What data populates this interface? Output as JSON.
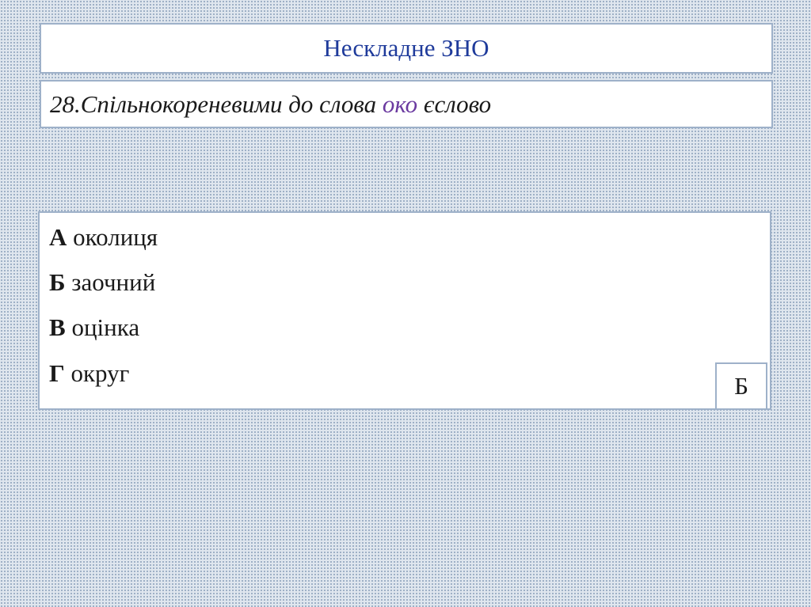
{
  "header": {
    "title": "Нескладне ЗНО"
  },
  "question": {
    "text_before": "28.Спільнокореневими до слова ",
    "keyword": "око",
    "text_after": " єслово",
    "keyword_color": "#6b3aa0"
  },
  "options": [
    {
      "letter": "А",
      "text": " околиця"
    },
    {
      "letter": "Б",
      "text": " заочний"
    },
    {
      "letter": "В",
      "text": " оцінка"
    },
    {
      "letter": "Г",
      "text": " округ"
    }
  ],
  "answer": {
    "value": "Б"
  },
  "colors": {
    "title": "#1f3b9b",
    "border": "#9eb1c9",
    "background": "#dfe6ee"
  }
}
